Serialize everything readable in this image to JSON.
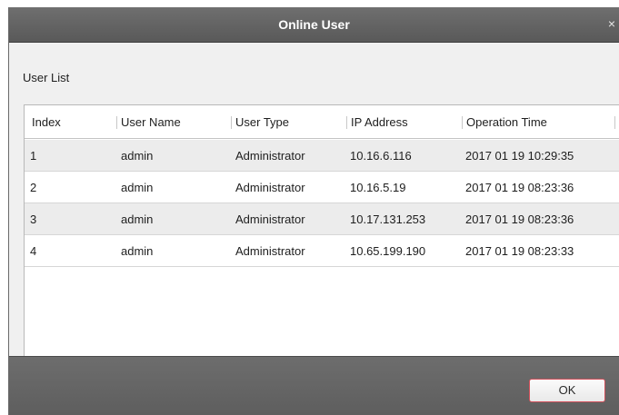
{
  "dialog": {
    "title": "Online User",
    "close_glyph": "×",
    "close_icon": "close-icon"
  },
  "section": {
    "label": "User List"
  },
  "table": {
    "columns": [
      "Index",
      "User Name",
      "User Type",
      "IP Address",
      "Operation Time"
    ],
    "rows": [
      [
        "1",
        "admin",
        "Administrator",
        "10.16.6.116",
        "2017 01 19 10:29:35"
      ],
      [
        "2",
        "admin",
        "Administrator",
        "10.16.5.19",
        "2017 01 19 08:23:36"
      ],
      [
        "3",
        "admin",
        "Administrator",
        "10.17.131.253",
        "2017 01 19 08:23:36"
      ],
      [
        "4",
        "admin",
        "Administrator",
        "10.65.199.190",
        "2017 01 19 08:23:33"
      ]
    ]
  },
  "footer": {
    "ok_label": "OK"
  },
  "colors": {
    "titlebar": "#5f5f5f",
    "footer": "#666666",
    "ok_border": "#d1505a",
    "alt_row": "#ececec"
  }
}
